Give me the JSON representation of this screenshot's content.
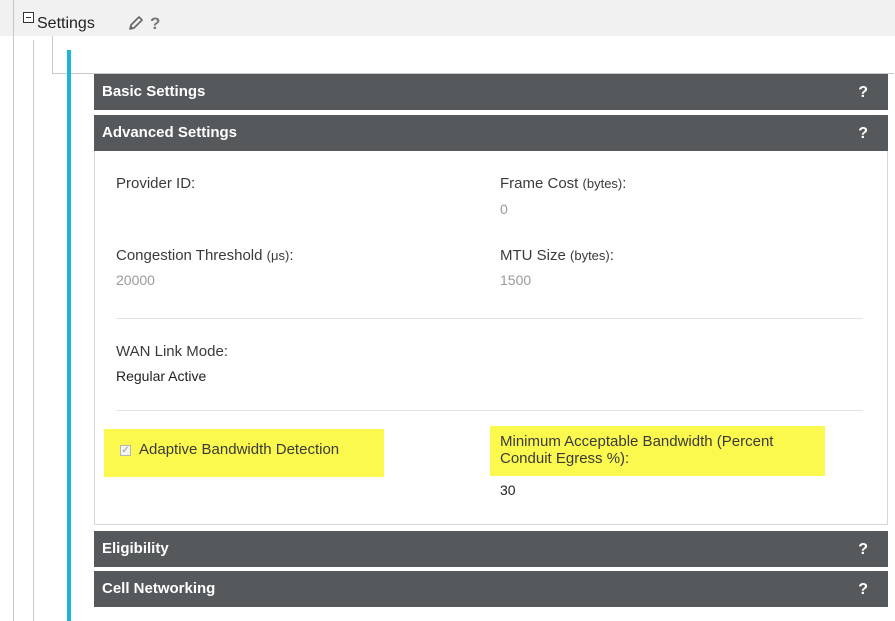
{
  "header": {
    "title": "Settings",
    "help_mark": "?"
  },
  "sections": {
    "basic": {
      "label": "Basic Settings",
      "help": "?"
    },
    "advanced": {
      "label": "Advanced Settings",
      "help": "?"
    },
    "eligibility": {
      "label": "Eligibility",
      "help": "?"
    },
    "cell": {
      "label": "Cell Networking",
      "help": "?"
    }
  },
  "advanced": {
    "provider_id": {
      "label": "Provider ID:",
      "value": ""
    },
    "frame_cost": {
      "label": "Frame Cost",
      "unit": "(bytes)",
      "colon": ":",
      "value": "0"
    },
    "congestion": {
      "label": "Congestion Threshold",
      "unit": "(μs)",
      "colon": ":",
      "value": "20000"
    },
    "mtu": {
      "label": "MTU Size",
      "unit": "(bytes)",
      "colon": ":",
      "value": "1500"
    },
    "wan_mode": {
      "label": "WAN Link Mode:",
      "value": "Regular Active"
    },
    "adaptive": {
      "label": "Adaptive Bandwidth Detection",
      "checked": true,
      "check_glyph": "✓"
    },
    "min_bandwidth": {
      "label_line1": "Minimum Acceptable Bandwidth (Percent",
      "label_line2": "Conduit Egress %):",
      "value": "30"
    }
  },
  "colors": {
    "header_bg": "#55595c",
    "accent_teal": "#1eb4d4",
    "highlight": "#fbf94e"
  }
}
